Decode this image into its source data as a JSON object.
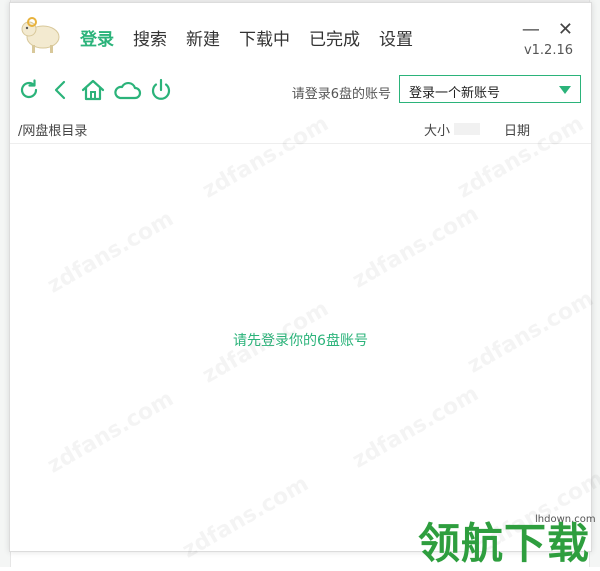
{
  "app": {
    "version": "v1.2.16"
  },
  "nav": {
    "items": [
      {
        "label": "登录",
        "active": true
      },
      {
        "label": "搜索",
        "active": false
      },
      {
        "label": "新建",
        "active": false
      },
      {
        "label": "下载中",
        "active": false
      },
      {
        "label": "已完成",
        "active": false
      },
      {
        "label": "设置",
        "active": false
      }
    ]
  },
  "window_controls": {
    "minimize": "—",
    "close": "✕"
  },
  "toolbar": {
    "icons": [
      "refresh-icon",
      "back-icon",
      "home-icon",
      "cloud-icon",
      "power-icon"
    ],
    "login_hint": "请登录6盘的账号",
    "account_select": {
      "selected": "登录一个新账号"
    }
  },
  "table": {
    "headers": {
      "path": "/网盘根目录",
      "size": "大小",
      "date": "日期"
    }
  },
  "main": {
    "empty_message": "请先登录你的6盘账号"
  },
  "watermark": {
    "text": "zdfans.com"
  },
  "overlay": {
    "brand": "领航下载",
    "url": "lhdown.com"
  },
  "colors": {
    "accent": "#2bb37a",
    "brand_green": "#2e9e3e"
  }
}
